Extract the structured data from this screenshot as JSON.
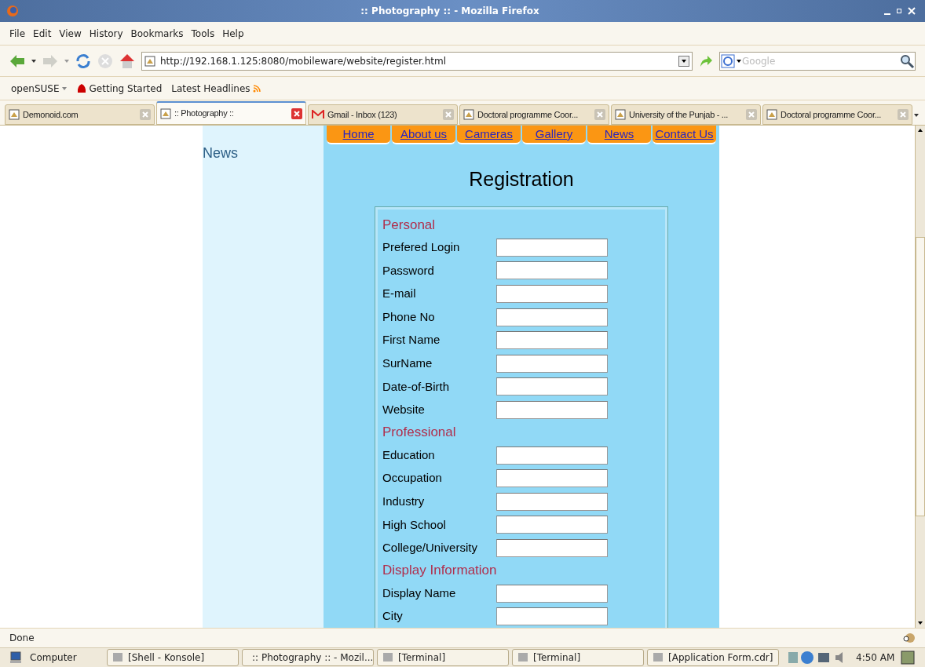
{
  "window": {
    "title": ":: Photography :: - Mozilla Firefox"
  },
  "menu": [
    "File",
    "Edit",
    "View",
    "History",
    "Bookmarks",
    "Tools",
    "Help"
  ],
  "address": {
    "value": "http://192.168.1.125:8080/mobileware/website/register.html"
  },
  "search": {
    "placeholder": "Google"
  },
  "bookmarks": [
    {
      "label": "openSUSE",
      "kind": "menu"
    },
    {
      "label": "Getting Started",
      "kind": "page"
    },
    {
      "label": "Latest Headlines",
      "kind": "feed"
    }
  ],
  "tabs": [
    {
      "label": "Demonoid.com",
      "selected": false
    },
    {
      "label": ":: Photography ::",
      "selected": true
    },
    {
      "label": "Gmail - Inbox (123)",
      "selected": false
    },
    {
      "label": "Doctoral programme Coor...",
      "selected": false
    },
    {
      "label": "University of the Punjab - ...",
      "selected": false
    },
    {
      "label": "Doctoral programme Coor...",
      "selected": false
    }
  ],
  "sidebar": {
    "title": "News"
  },
  "site_nav": [
    "Home",
    "About us",
    "Cameras",
    "Gallery",
    "News",
    "Contact Us"
  ],
  "page_title": "Registration",
  "form": [
    {
      "kind": "heading",
      "label": "Personal"
    },
    {
      "kind": "field",
      "label": "Prefered Login"
    },
    {
      "kind": "field",
      "label": "Password"
    },
    {
      "kind": "field",
      "label": "E-mail"
    },
    {
      "kind": "field",
      "label": "Phone No"
    },
    {
      "kind": "field",
      "label": "First Name"
    },
    {
      "kind": "field",
      "label": "SurName"
    },
    {
      "kind": "field",
      "label": "Date-of-Birth"
    },
    {
      "kind": "field",
      "label": "Website"
    },
    {
      "kind": "heading",
      "label": "Professional"
    },
    {
      "kind": "field",
      "label": "Education"
    },
    {
      "kind": "field",
      "label": "Occupation"
    },
    {
      "kind": "field",
      "label": "Industry"
    },
    {
      "kind": "field",
      "label": "High School"
    },
    {
      "kind": "field",
      "label": "College/University"
    },
    {
      "kind": "heading",
      "label": "Display Information"
    },
    {
      "kind": "field",
      "label": "Display Name"
    },
    {
      "kind": "field",
      "label": "City"
    }
  ],
  "status_bar": {
    "text": "Done"
  },
  "taskbar": {
    "start": "Computer",
    "items": [
      "[Shell - Konsole]",
      ":: Photography :: - Mozil...",
      "[Terminal]",
      "[Terminal]",
      "[Application Form.cdr]"
    ],
    "clock": "4:50 AM"
  }
}
